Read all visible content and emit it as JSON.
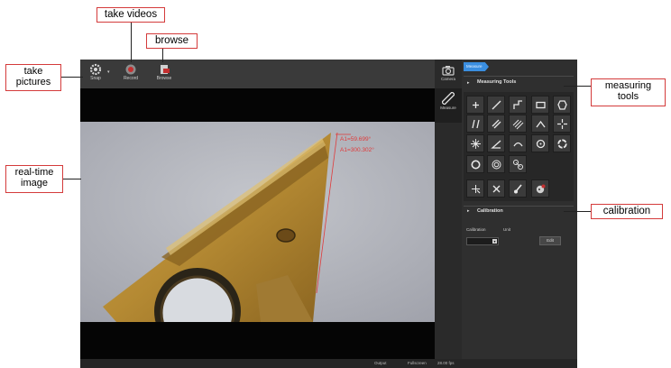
{
  "toolbar": {
    "snap_label": "Snap",
    "record_label": "Record",
    "browse_label": "Browse"
  },
  "modes": {
    "camera_label": "Camera",
    "measure_label": "Measure"
  },
  "panel": {
    "tab_label": "Measure",
    "measuring_tools_title": "Measuring Tools",
    "calibration_title": "Calibration",
    "calibration_field_label": "Calibration",
    "unit_field_label": "Unit",
    "edit_button_label": "Edit"
  },
  "measurement": {
    "angle1": "A1=59.699°",
    "angle2": "A1=300.302°"
  },
  "status": {
    "output": "Output",
    "fullscreen": "Fullscreen",
    "fps": "28.00 fps"
  },
  "annotations": {
    "take_pictures": "take pictures",
    "take_videos": "take videos",
    "browse": "browse",
    "realtime_image": "real-time image",
    "measuring_tools": "measuring tools",
    "calibration": "calibration"
  },
  "colors": {
    "accent": "#3a8ee0",
    "callout_border": "#d43b3b",
    "measure_text": "#e03a3a"
  }
}
